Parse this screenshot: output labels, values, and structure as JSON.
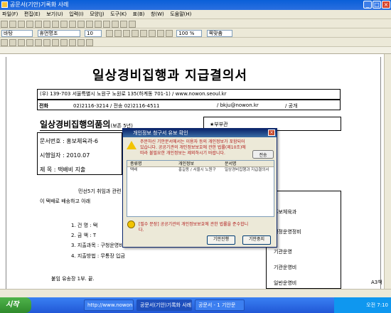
{
  "window": {
    "title": "공문서(기안)기록화 사례"
  },
  "menu": [
    "파일(F)",
    "편집(E)",
    "보기(U)",
    "입력(I)",
    "모양(J)",
    "도구(K)",
    "표(B)",
    "창(W)",
    "도움말(H)"
  ],
  "toolbar": {
    "style": "바탕",
    "font": "휴먼명조",
    "size": "10",
    "zoom": "100 %",
    "view": "쪽맞춤"
  },
  "document": {
    "title": "일상경비집행과 지급결의서",
    "address": "(우) 139-703  서울특별시 노원구 노원로 135(하계동 701-1) / www.nowon.seoul.kr",
    "phone_label": "전화",
    "phone": "02)2116-3214 / 전송 02)2116-4511",
    "email": "/ bkju@nowon.kr",
    "disclosure": "/ 공개",
    "section_title": "일상경비집행의품의",
    "section_suffix": "(보존 5년)",
    "doc_no_label": "문서번호 :",
    "doc_no": "홍보체육과-6",
    "date_label": "시행일자 :",
    "date": "2010.07",
    "subject_label": "제 목 :",
    "subject": "택배비 지출",
    "body1": "민선5기 취임과 관련",
    "body2": "이 택배로 배송하고 아래",
    "list": [
      "1. 건  명 : 택",
      "2. 금 액 : T",
      "3. 지출과목 : 구청운영비(W10,000)",
      "4. 지출방법 : 무통장 입금"
    ],
    "footer": "붙임 유송장 1부. 끝.",
    "right_header": "★부부관",
    "right_col": [
      "홍보체육과",
      "행정운영정비",
      "기관운영",
      "기관운영비",
      "일반운영비"
    ],
    "page_indicator": "A3책"
  },
  "dialog": {
    "title": "개인정보 청구서 유보 확인",
    "message": "주문하신 기안문서에서는 이용자 등의 개인정보가 포함되어 있습니다. 공공기관의 개인정보보호에 관한 법률(제10조)에 따라 불필요한 개인정보는 제외하시기 바랍니다.",
    "send_btn": "전송",
    "columns": [
      "종류명",
      "개인정보",
      "문서명"
    ],
    "rows": [
      [
        "택배",
        "홍길동 / 서울시 노원구",
        "일상경비집행과 지급결의서"
      ]
    ],
    "note": "[필수 문장] 공공기관의 개인정보보호에 관한 법률을 준수합니다.",
    "btn_ok": "기안진행",
    "btn_cancel": "기안중지"
  },
  "taskbar": {
    "start": "시작",
    "tasks": [
      "http://www.nowon...",
      "공문서(기안)기록화 사례",
      "공문서 - 1 기안문"
    ],
    "time": "오전 7:10"
  }
}
